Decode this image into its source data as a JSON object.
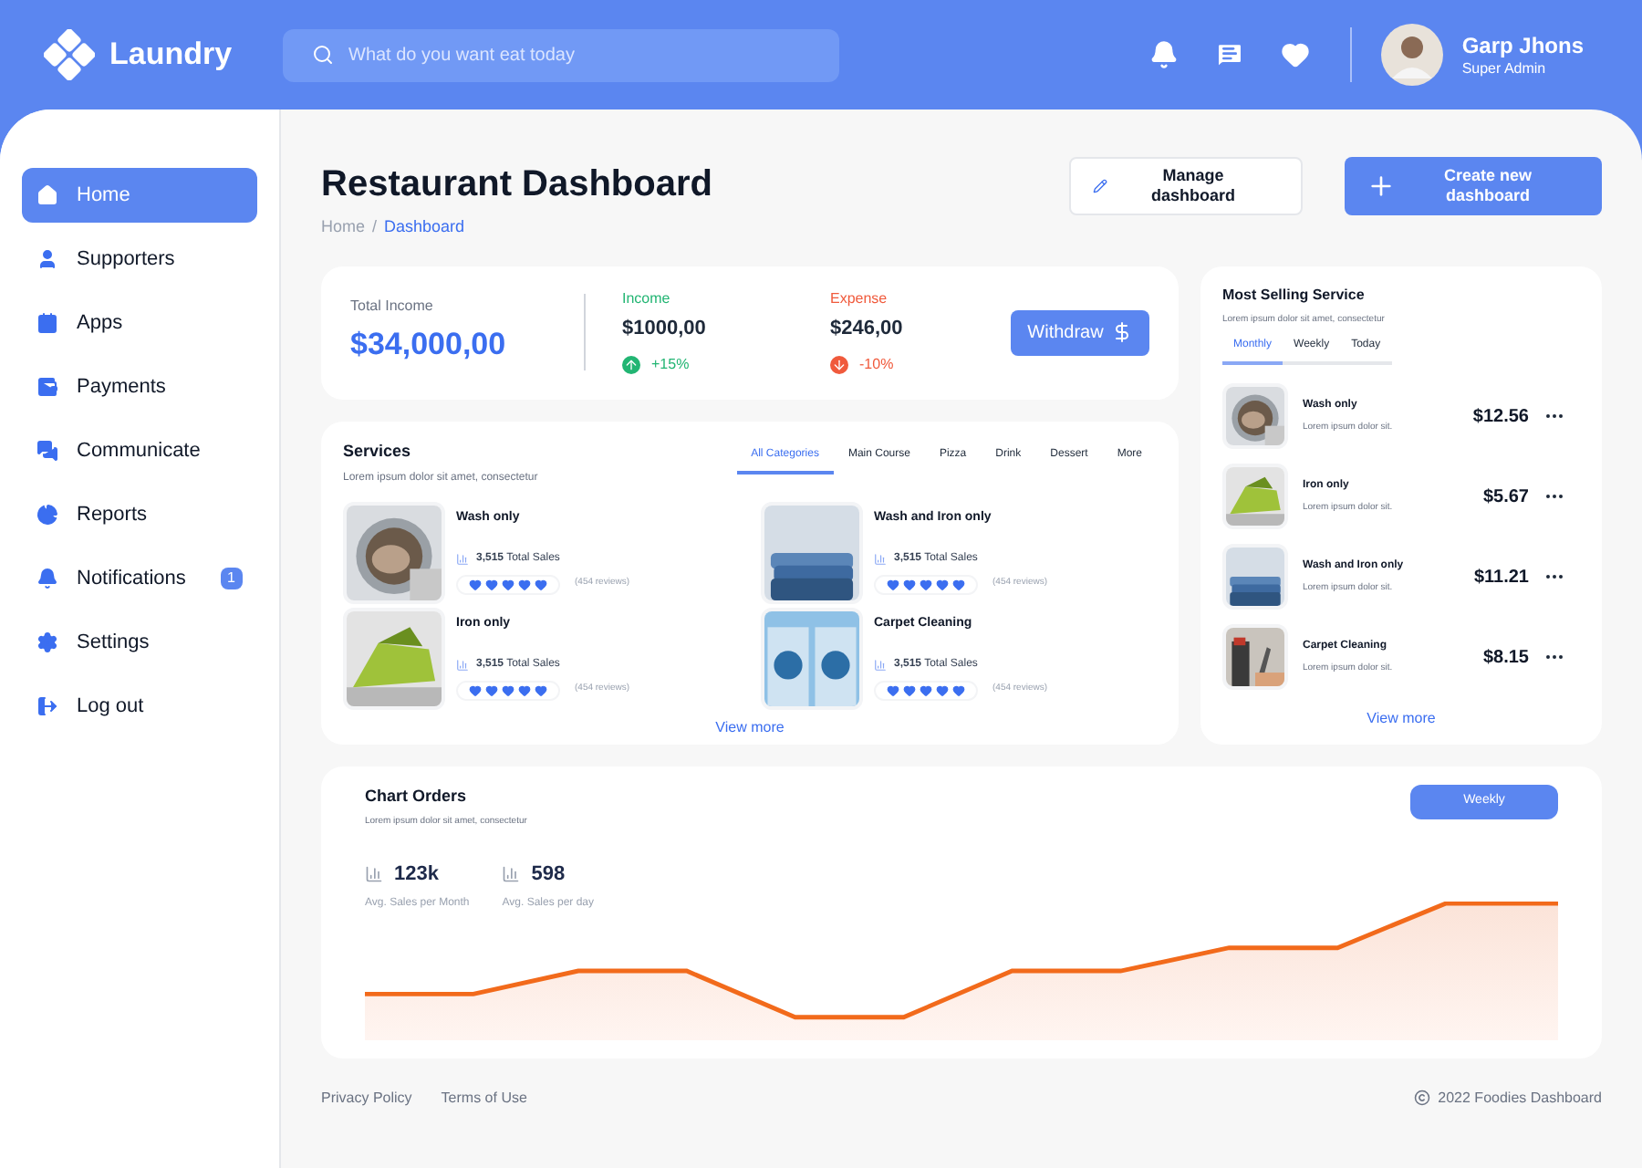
{
  "header": {
    "logo": "Laundry",
    "search": {
      "placeholder": "What do you want eat today"
    },
    "user": {
      "name": "Garp Jhons",
      "role": "Super Admin"
    }
  },
  "sidebar": {
    "items": [
      {
        "label": "Home",
        "selected": true
      },
      {
        "label": "Supporters",
        "selected": false
      },
      {
        "label": "Apps",
        "selected": false
      },
      {
        "label": "Payments",
        "selected": false
      },
      {
        "label": "Communicate",
        "selected": false
      },
      {
        "label": "Reports",
        "selected": false
      },
      {
        "label": "Notifications",
        "selected": false,
        "badge": "1"
      },
      {
        "label": "Settings",
        "selected": false
      },
      {
        "label": "Log out",
        "selected": false
      }
    ]
  },
  "page": {
    "title": "Restaurant Dashboard",
    "breadcrumb": [
      "Home",
      "/",
      "Dashboard"
    ],
    "buttons": [
      "Manage dashboard",
      "Create new dashboard"
    ]
  },
  "summary": {
    "total_label": "Total Income",
    "total": "$34,000,00",
    "income": {
      "label": "Income",
      "value": "$1000,00",
      "change": "+15%"
    },
    "expense": {
      "label": "Expense",
      "value": "$246,00",
      "change": "-10%"
    },
    "withdraw": "Withdraw"
  },
  "services": {
    "title": "Services",
    "subtitle": "Lorem ipsum dolor sit amet, consectetur",
    "tabs": [
      {
        "label": "All Categories",
        "selected": true
      },
      {
        "label": "Main Course",
        "selected": false
      },
      {
        "label": "Pizza",
        "selected": false
      },
      {
        "label": "Drink",
        "selected": false
      },
      {
        "label": "Dessert",
        "selected": false
      },
      {
        "label": "More",
        "selected": false
      }
    ],
    "items": [
      {
        "name": "Wash only",
        "sales": "3,515",
        "sales_label": "Total Sales",
        "stars": 5,
        "reviews": "(454 reviews)",
        "kind": "picture"
      },
      {
        "name": "Wash and Iron only",
        "sales": "3,515",
        "sales_label": "Total Sales",
        "stars": 5,
        "reviews": "(454 reviews)",
        "kind": "picture"
      },
      {
        "name": "Iron only",
        "sales": "3,515",
        "sales_label": "Total Sales",
        "stars": 5,
        "reviews": "(454 reviews)",
        "kind": "picture"
      },
      {
        "name": "Carpet Cleaning",
        "sales": "3,515",
        "sales_label": "Total Sales",
        "stars": 5,
        "reviews": "(454 reviews)",
        "kind": "picture"
      }
    ],
    "view_more": "View more"
  },
  "most_selling": {
    "title": "Most Selling Service",
    "subtitle": "Lorem ipsum dolor sit amet, consectetur",
    "tabs": [
      {
        "label": "Monthly",
        "selected": true
      },
      {
        "label": "Weekly",
        "selected": false
      },
      {
        "label": "Today",
        "selected": false
      }
    ],
    "items": [
      {
        "name": "Wash only",
        "description": "Lorem ipsum dolor sit.",
        "price": "$12.56",
        "kind": "picture"
      },
      {
        "name": "Iron only",
        "description": "Lorem ipsum dolor sit.",
        "price": "$5.67",
        "kind": "picture"
      },
      {
        "name": "Wash and Iron only",
        "description": "Lorem ipsum dolor sit.",
        "price": "$11.21",
        "kind": "picture"
      },
      {
        "name": "Carpet Cleaning",
        "description": "Lorem ipsum dolor sit.",
        "price": "$8.15",
        "kind": "picture"
      }
    ],
    "view_more": "View more"
  },
  "chart_orders": {
    "title": "Chart Orders",
    "subtitle": "Lorem ipsum dolor sit amet, consectetur",
    "button": "Weekly",
    "stats": [
      {
        "value": "123k",
        "label": "Avg. Sales per Month"
      },
      {
        "value": "598",
        "label": "Avg. Sales per day"
      }
    ]
  },
  "footer": {
    "links": [
      "Privacy Policy",
      "Terms of Use"
    ],
    "copyright": "2022 Foodies Dashboard"
  }
}
